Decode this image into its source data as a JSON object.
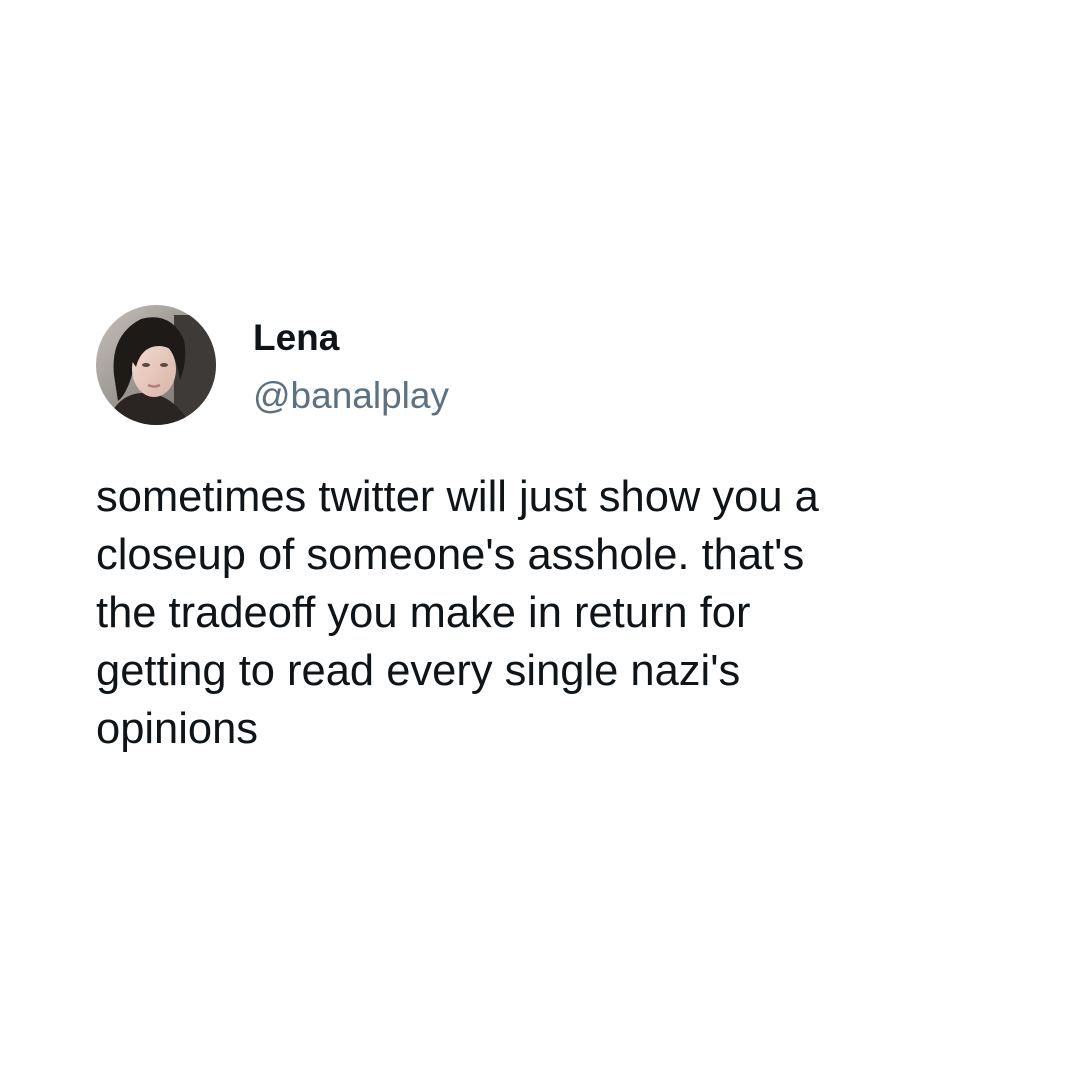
{
  "tweet": {
    "author": {
      "display_name": "Lena",
      "handle": "@banalplay",
      "avatar_icon": "profile-photo-avatar"
    },
    "text": "sometimes twitter will just show you a\ncloseup of someone's asshole. that's\nthe tradeoff you make in return for\ngetting to read every single nazi's\nopinions"
  },
  "colors": {
    "background": "#ffffff",
    "text_primary": "#0f1419",
    "text_secondary": "#5b7083"
  }
}
